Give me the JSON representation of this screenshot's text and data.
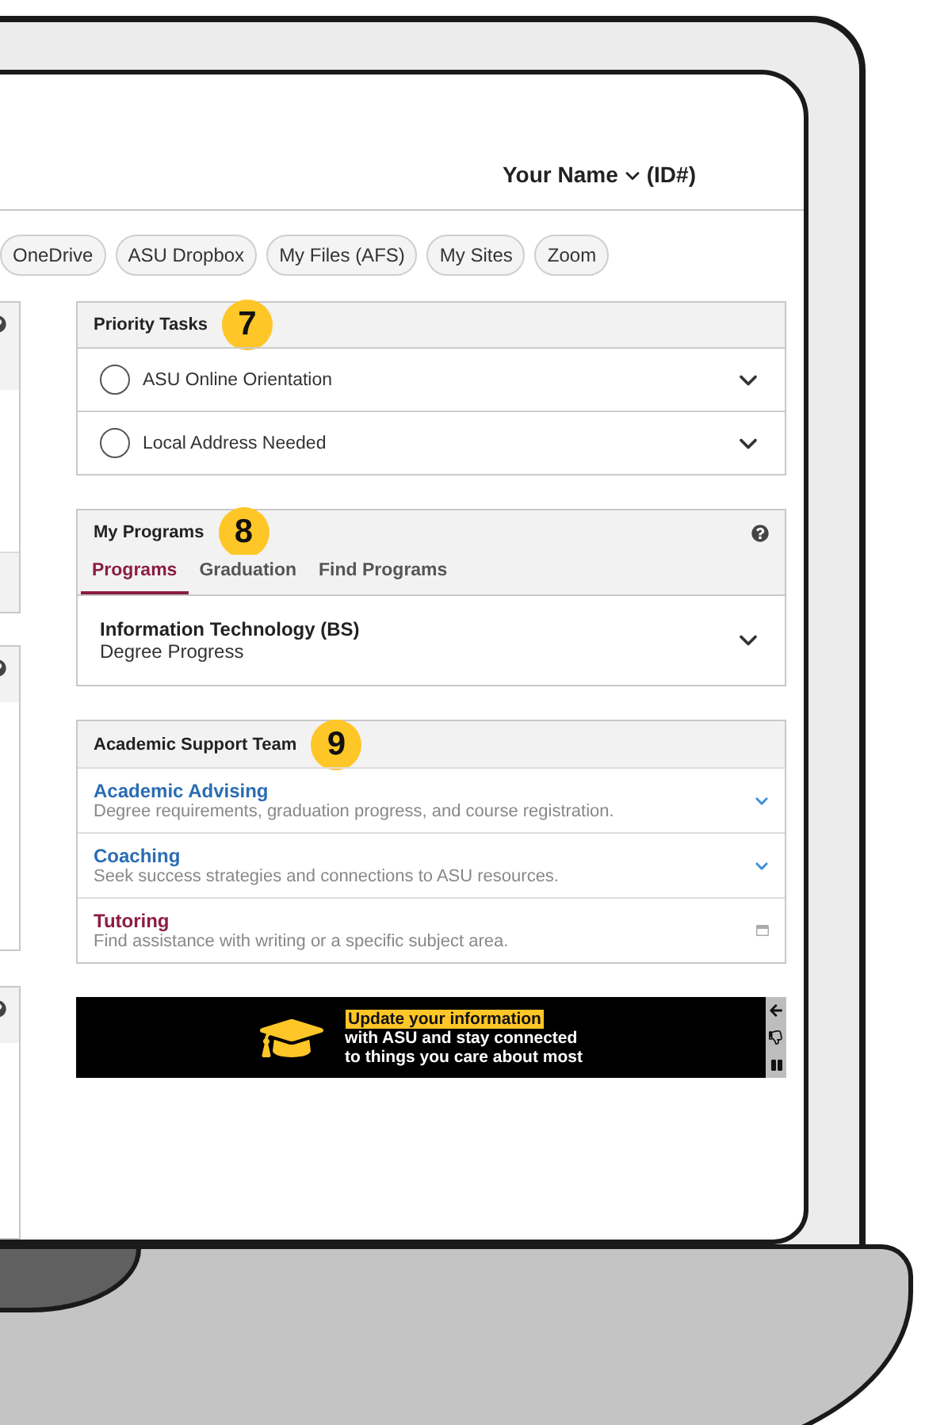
{
  "header": {
    "user_name": "Your Name",
    "user_id": "(ID#)"
  },
  "quick_links": [
    "OneDrive",
    "ASU Dropbox",
    "My Files (AFS)",
    "My Sites",
    "Zoom"
  ],
  "priority_tasks": {
    "title": "Priority Tasks",
    "badge": "7",
    "tasks": [
      {
        "label": "ASU Online Orientation",
        "checked": false
      },
      {
        "label": "Local Address Needed",
        "checked": false
      }
    ]
  },
  "my_programs": {
    "title": "My Programs",
    "badge": "8",
    "tabs": [
      {
        "label": "Programs",
        "selected": true
      },
      {
        "label": "Graduation",
        "selected": false
      },
      {
        "label": "Find Programs",
        "selected": false
      }
    ],
    "programs": [
      {
        "name": "Information Technology (BS)",
        "detail": "Degree Progress"
      }
    ]
  },
  "academic_support_team": {
    "title": "Academic Support Team",
    "badge": "9",
    "items": [
      {
        "title": "Academic Advising",
        "description": "Degree requirements, graduation progress, and course registration.",
        "color": "#2a6db3",
        "kind": "expandable"
      },
      {
        "title": "Coaching",
        "description": "Seek success strategies and connections to ASU resources.",
        "color": "#2a6db3",
        "kind": "expandable"
      },
      {
        "title": "Tutoring",
        "description": "Find assistance with writing or a specific subject area.",
        "color": "#8c1d40",
        "kind": "external"
      }
    ]
  },
  "banner": {
    "highlight": "Update your information",
    "lines": [
      "with ASU and stay connected",
      "to things you care about most"
    ]
  }
}
